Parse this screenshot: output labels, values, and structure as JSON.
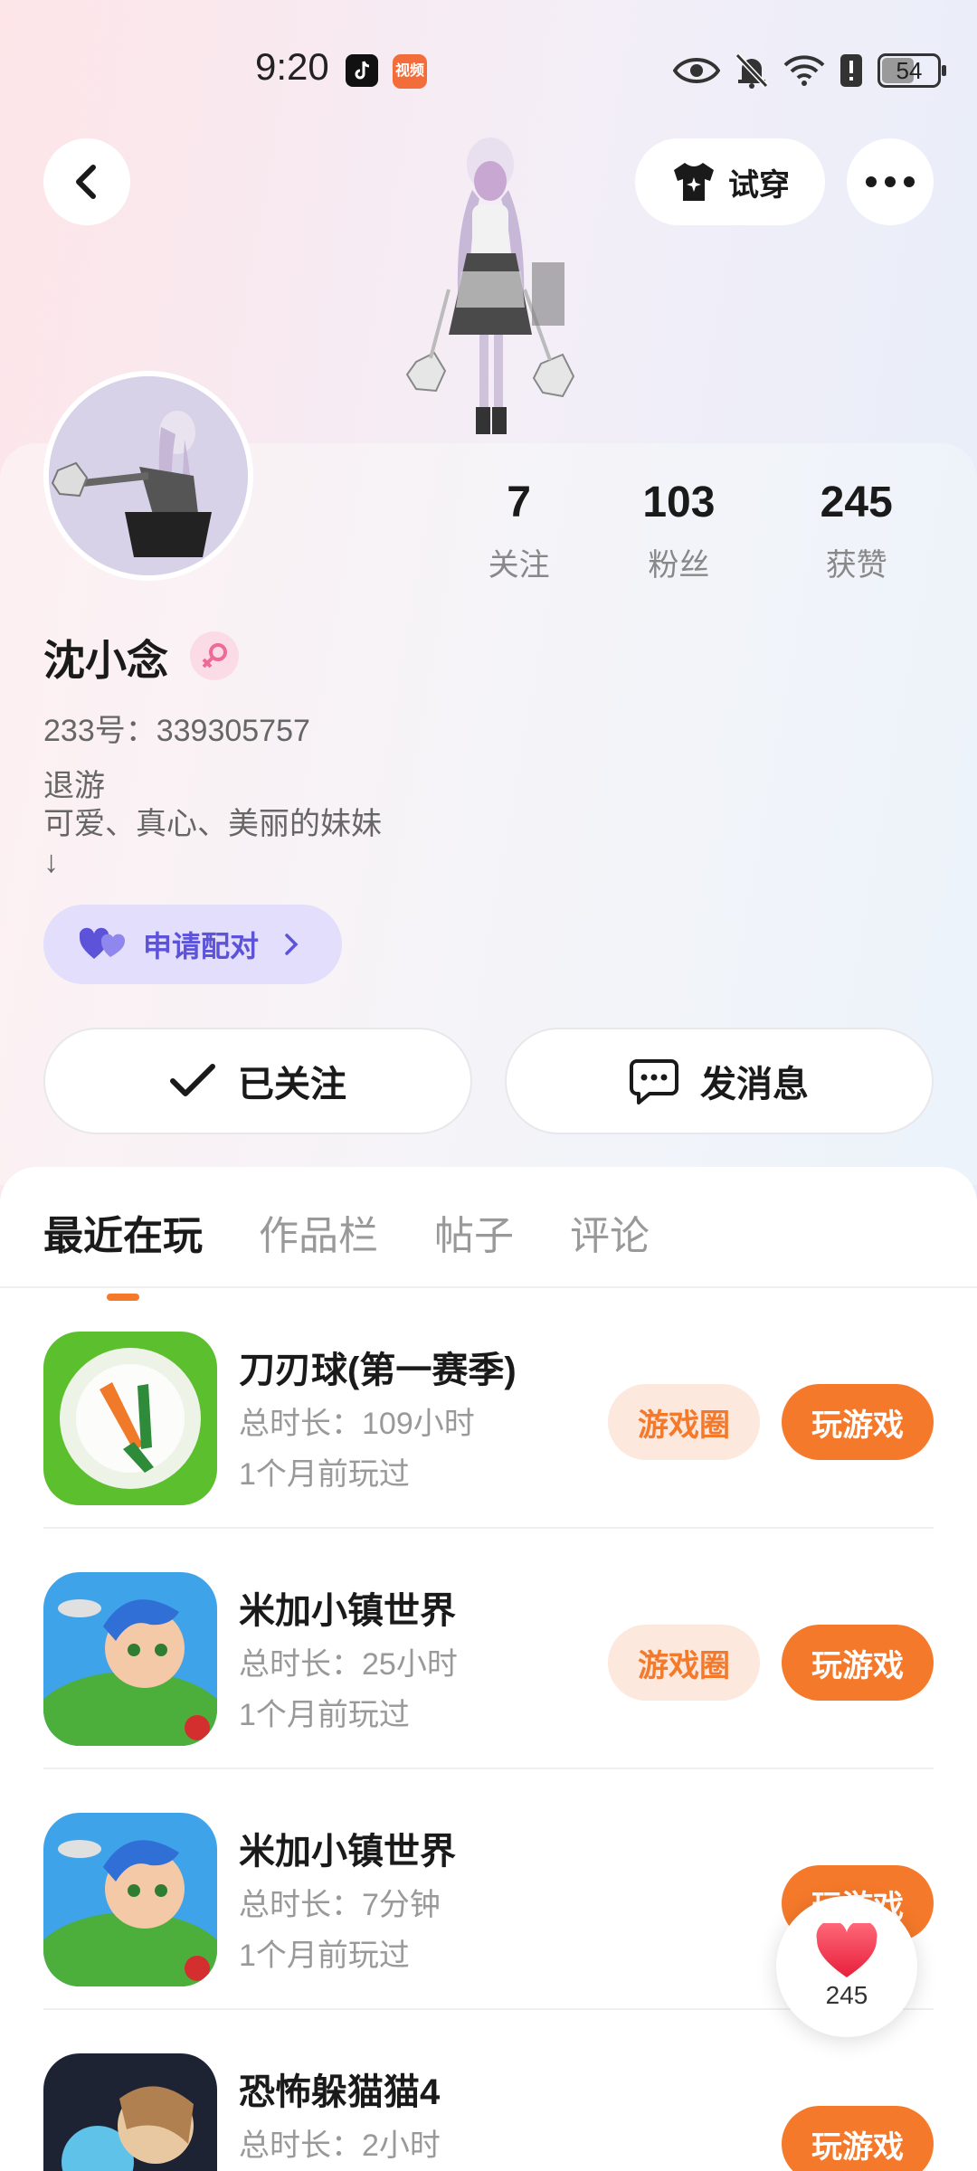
{
  "status_bar": {
    "time": "9:20",
    "battery": "54",
    "app2_icon_text": "视频"
  },
  "header": {
    "tryon_label": "试穿"
  },
  "profile": {
    "stats": [
      {
        "value": "7",
        "label": "关注"
      },
      {
        "value": "103",
        "label": "粉丝"
      },
      {
        "value": "245",
        "label": "获赞"
      }
    ],
    "name": "沈小念",
    "gender": "female",
    "uid": "233号：339305757",
    "bio_lines": [
      "退游",
      "可爱、真心、美丽的妹妹",
      "↓"
    ],
    "pair_label": "申请配对",
    "follow_label": "已关注",
    "message_label": "发消息"
  },
  "tabs": [
    "最近在玩",
    "作品栏",
    "帖子",
    "评论"
  ],
  "games": [
    {
      "name": "刀刃球(第一赛季)",
      "duration": "总时长：109小时",
      "last_played": "1个月前玩过",
      "circle_label": "游戏圈",
      "play_label": "玩游戏"
    },
    {
      "name": "米加小镇世界",
      "duration": "总时长：25小时",
      "last_played": "1个月前玩过",
      "circle_label": "游戏圈",
      "play_label": "玩游戏"
    },
    {
      "name": "米加小镇世界",
      "duration": "总时长：7分钟",
      "last_played": "1个月前玩过",
      "play_label": "玩游戏"
    },
    {
      "name": "恐怖躲猫猫4",
      "duration": "总时长：2小时",
      "play_label": "玩游戏"
    }
  ],
  "like_fab": {
    "count": "245"
  },
  "colors": {
    "accent": "#f5792a",
    "pair": "#5d53d8",
    "heart": "#f0304a"
  }
}
